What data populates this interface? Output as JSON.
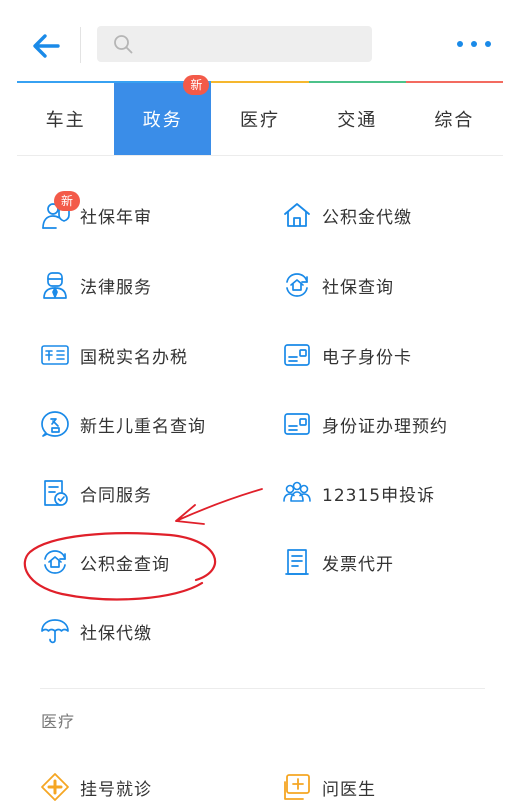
{
  "header": {
    "search_value": "",
    "search_placeholder": ""
  },
  "tabs": [
    {
      "label": "车主",
      "active": false,
      "badge": ""
    },
    {
      "label": "政务",
      "active": true,
      "badge": "新"
    },
    {
      "label": "医疗",
      "active": false,
      "badge": ""
    },
    {
      "label": "交通",
      "active": false,
      "badge": ""
    },
    {
      "label": "综合",
      "active": false,
      "badge": ""
    }
  ],
  "tab_top_colors": [
    "#37a1f2",
    "#37a1f2",
    "#f5b72e",
    "#4cc28a",
    "#f36b60"
  ],
  "services": [
    {
      "label": "社保年审",
      "icon": "person-shield-icon",
      "badge": "新"
    },
    {
      "label": "公积金代缴",
      "icon": "house-icon",
      "badge": ""
    },
    {
      "label": "法律服务",
      "icon": "lawyer-icon",
      "badge": ""
    },
    {
      "label": "社保查询",
      "icon": "house-shield-search-icon",
      "badge": ""
    },
    {
      "label": "国税实名办税",
      "icon": "tax-card-icon",
      "badge": ""
    },
    {
      "label": "电子身份卡",
      "icon": "id-card-icon",
      "badge": ""
    },
    {
      "label": "新生儿重名查询",
      "icon": "name-bubble-icon",
      "badge": ""
    },
    {
      "label": "身份证办理预约",
      "icon": "id-card-icon",
      "badge": ""
    },
    {
      "label": "合同服务",
      "icon": "contract-icon",
      "badge": ""
    },
    {
      "label": "12315申投诉",
      "icon": "people-group-icon",
      "badge": ""
    },
    {
      "label": "公积金查询",
      "icon": "house-shield-search-icon",
      "badge": ""
    },
    {
      "label": "发票代开",
      "icon": "invoice-icon",
      "badge": ""
    },
    {
      "label": "社保代缴",
      "icon": "umbrella-icon",
      "badge": ""
    }
  ],
  "medical_section": {
    "title": "医疗",
    "items": [
      {
        "label": "挂号就诊",
        "icon": "medical-cross-icon"
      },
      {
        "label": "问医生",
        "icon": "doctor-chat-icon"
      }
    ]
  },
  "colors": {
    "accent": "#1a8ae8",
    "active_tab": "#3a8de8",
    "badge": "#f35a49",
    "annotation": "#e0202a",
    "medical_icon": "#f5a623"
  }
}
